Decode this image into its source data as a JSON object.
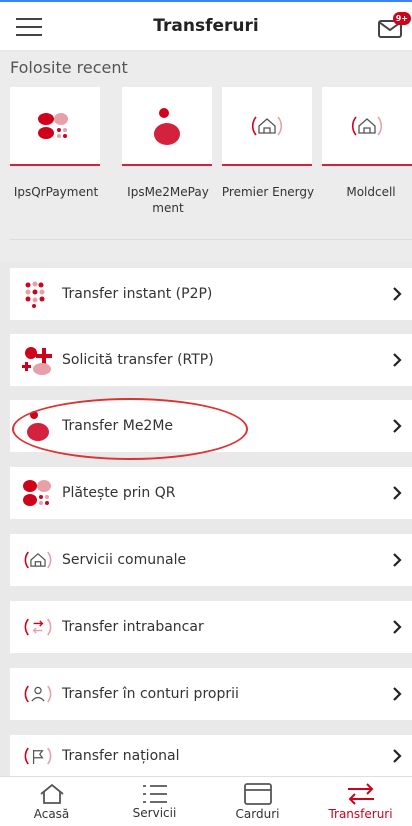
{
  "header": {
    "title": "Transferuri",
    "notification_badge": "9+"
  },
  "recent": {
    "label": "Folosite recent",
    "items": [
      {
        "label": "IpsQrPayment",
        "icon": "qr-payment-icon"
      },
      {
        "label": "IpsMe2MePay\nment",
        "icon": "me2me-icon"
      },
      {
        "label": "Premier Energy",
        "icon": "utilities-house-icon"
      },
      {
        "label": "Moldcell",
        "icon": "utilities-house-icon"
      }
    ]
  },
  "menu": [
    {
      "label": "Transfer instant (P2P)",
      "icon": "instant-transfer-icon"
    },
    {
      "label": "Solicită transfer (RTP)",
      "icon": "request-transfer-icon"
    },
    {
      "label": "Transfer Me2Me",
      "icon": "me2me-icon"
    },
    {
      "label": "Plătește prin QR",
      "icon": "qr-payment-icon"
    },
    {
      "label": "Servicii comunale",
      "icon": "utilities-house-icon"
    },
    {
      "label": "Transfer intrabancar",
      "icon": "intrabank-transfer-icon"
    },
    {
      "label": "Transfer în conturi proprii",
      "icon": "own-accounts-transfer-icon"
    },
    {
      "label": "Transfer național",
      "icon": "national-transfer-icon"
    }
  ],
  "nav": [
    {
      "label": "Acasă",
      "icon": "home-icon"
    },
    {
      "label": "Servicii",
      "icon": "list-icon"
    },
    {
      "label": "Carduri",
      "icon": "card-icon"
    },
    {
      "label": "Transferuri",
      "icon": "transfer-arrows-icon",
      "active": true
    }
  ],
  "colors": {
    "brand": "#d0021b",
    "pink": "#e8a0a8",
    "row_bg": "#ffffff",
    "page_bg": "#e9e9e9"
  }
}
